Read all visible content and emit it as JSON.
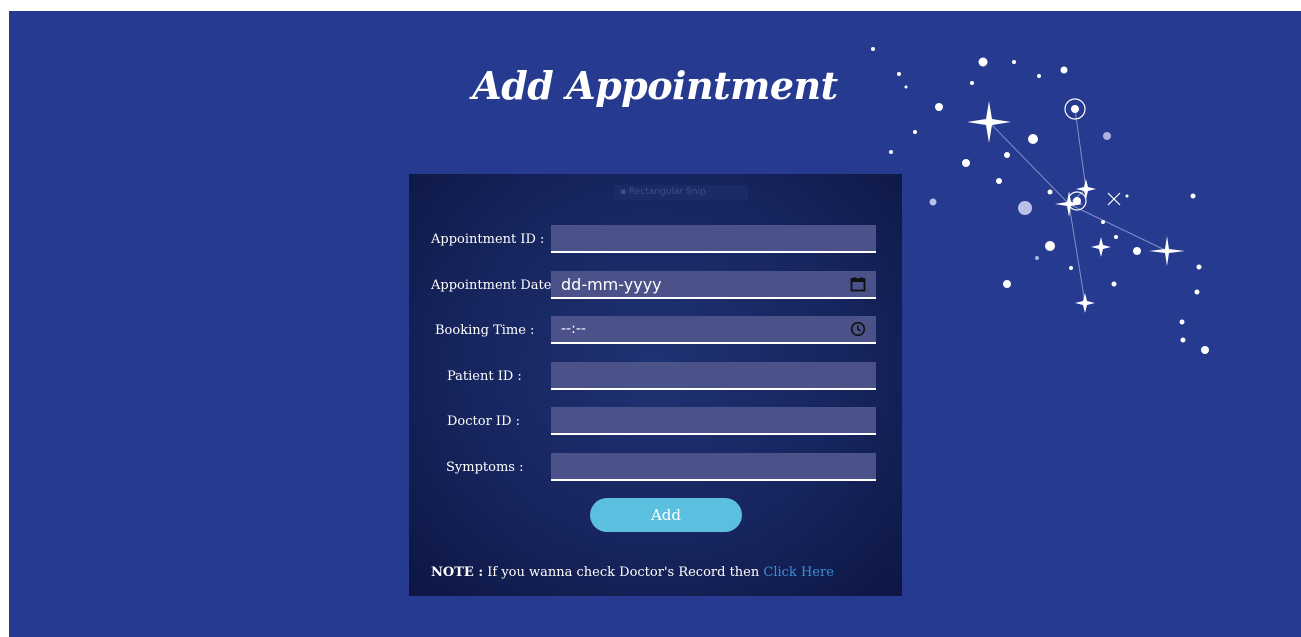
{
  "page": {
    "title": "Add Appointment",
    "background": "#263a8f"
  },
  "form": {
    "top_image_alt": "Rectangular Snip",
    "fields": [
      {
        "label": "Appointment ID :",
        "value": ""
      },
      {
        "label": "Appointment Date :",
        "placeholder": "dd-mm-yyyy",
        "icon": "calendar-icon"
      },
      {
        "label": "Booking Time :",
        "placeholder": "--:--",
        "icon": "clock-icon"
      },
      {
        "label": "Patient ID :",
        "value": ""
      },
      {
        "label": "Doctor ID :",
        "value": ""
      },
      {
        "label": "Symptoms :",
        "value": ""
      }
    ],
    "submit_label": "Add",
    "button_color": "#5bc0e0"
  },
  "note": {
    "prefix": "NOTE :",
    "text": " If you wanna check Doctor's Record then ",
    "link": "Click Here",
    "link_color": "#3a8fd6"
  }
}
